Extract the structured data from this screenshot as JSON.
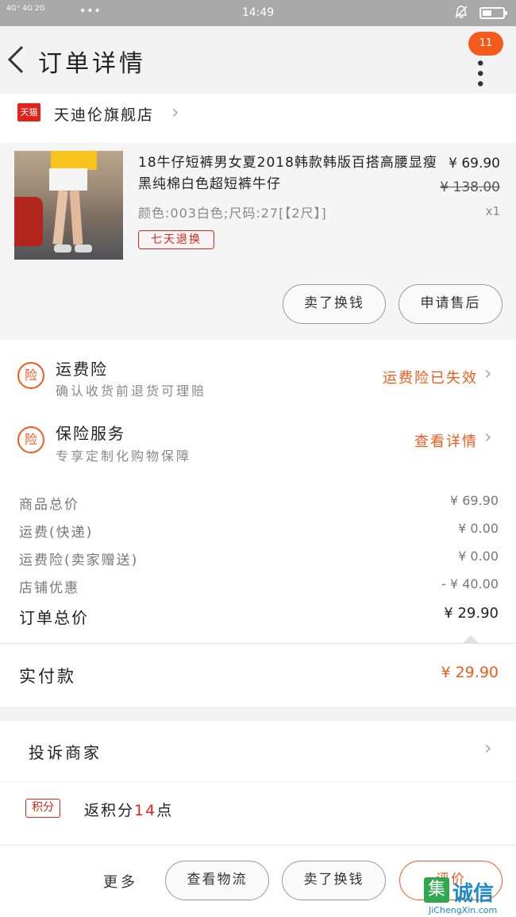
{
  "statusbar": {
    "signal": "4G⁺ 4G 2G",
    "dots": "•••",
    "time": "14:49",
    "bell_icon": "bell-muted-icon",
    "battery_icon": "battery-icon"
  },
  "navbar": {
    "title": "订单详情",
    "badge": "11",
    "more": "•••"
  },
  "shop": {
    "logo": "天猫",
    "name": "天迪伦旗舰店"
  },
  "product": {
    "title": "18牛仔短裤男女夏2018韩款韩版百搭高腰显瘦黑纯棉白色超短裤牛仔",
    "price": "¥ 69.90",
    "original_price": "¥ 138.00",
    "quantity": "x1",
    "sku": "颜色:003白色;尺码:27[【2尺】]",
    "tag": "七天退换",
    "buttons": {
      "refund": "卖了换钱",
      "after_sale": "申请售后"
    }
  },
  "insurance": [
    {
      "icon": "险",
      "title": "运费险",
      "subtitle": "确认收货前退货可理赔",
      "link": "运费险已失效"
    },
    {
      "icon": "险",
      "title": "保险服务",
      "subtitle": "专享定制化购物保障",
      "link": "查看详情"
    }
  ],
  "fees": [
    {
      "label": "商品总价",
      "value": "¥ 69.90"
    },
    {
      "label": "运费(快递)",
      "value": "¥ 0.00"
    },
    {
      "label": "运费险(卖家赠送)",
      "value": "¥ 0.00"
    },
    {
      "label": "店铺优惠",
      "value": "- ¥ 40.00"
    }
  ],
  "total": {
    "label": "订单总价",
    "value": "¥ 29.90"
  },
  "paid": {
    "label": "实付款",
    "value": "¥ 29.90"
  },
  "complain": {
    "label": "投诉商家"
  },
  "points": {
    "badge": "积分",
    "prefix": "返积分",
    "number": "14",
    "suffix": "点"
  },
  "bottom": {
    "more": "更多",
    "logistics": "查看物流",
    "resell": "卖了换钱",
    "review": "评价"
  },
  "watermark": {
    "mark": "集",
    "brand": "诚信",
    "url": "JiChengXin.com"
  },
  "colors": {
    "accent": "#f45a1c",
    "tmall": "#e2231a",
    "statusbar": "#a9a9a9"
  }
}
